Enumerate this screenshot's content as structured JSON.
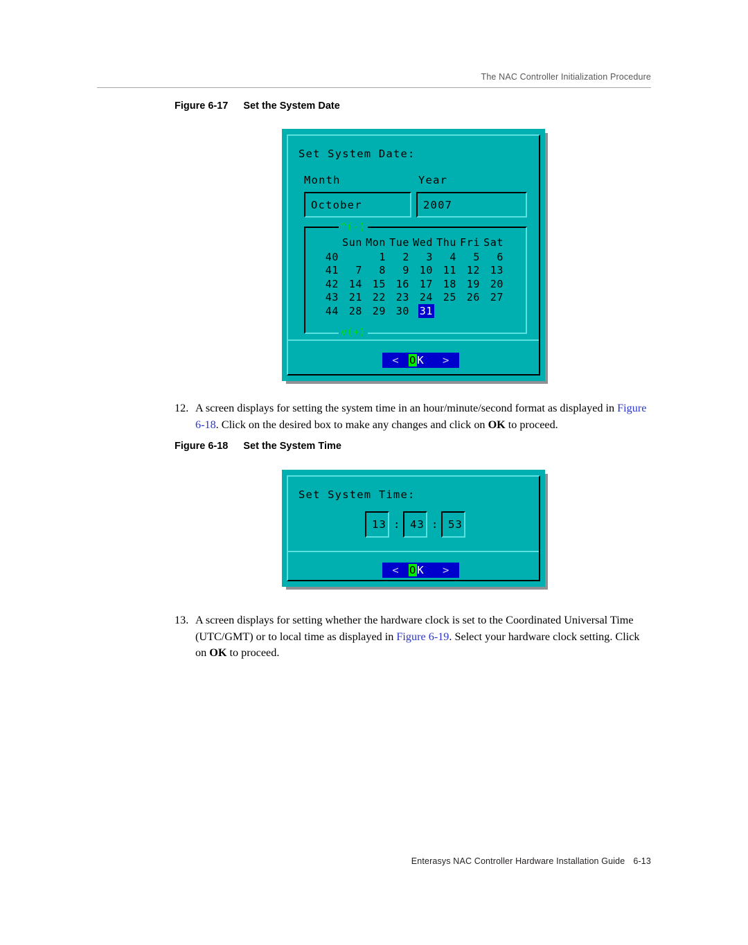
{
  "header": {
    "running_title": "The NAC Controller Initialization Procedure"
  },
  "footer": {
    "guide_title": "Enterasys NAC Controller Hardware Installation Guide",
    "page_number": "6-13"
  },
  "figures": [
    {
      "number": "Figure 6-17",
      "title": "Set the System Date"
    },
    {
      "number": "Figure 6-18",
      "title": "Set the System Time"
    }
  ],
  "steps": [
    {
      "number": "12.",
      "part1": "A screen displays for setting the system time in an hour/minute/second format as displayed in ",
      "xref": "Figure 6-18",
      "part2": ". Click on the desired box to make any changes and click on ",
      "bold": "OK",
      "part3": " to proceed."
    },
    {
      "number": "13.",
      "part1": "A screen displays for setting whether the hardware clock is set to the Coordinated Universal Time (UTC/GMT) or to local time as displayed in ",
      "xref": "Figure 6-19",
      "part2": ". Select your hardware clock setting. Click on ",
      "bold": "OK",
      "part3": " to proceed."
    }
  ],
  "date_dialog": {
    "title": "Set System Date:",
    "month_label": "Month",
    "year_label": "Year",
    "month_value": "October",
    "year_value": "2007",
    "scroll_up": "^(-)",
    "scroll_down": "v(+)",
    "weekday_headers": [
      "",
      "Sun",
      "Mon",
      "Tue",
      "Wed",
      "Thu",
      "Fri",
      "Sat"
    ],
    "weeks": [
      {
        "week": "40",
        "days": [
          "",
          "1",
          "2",
          "3",
          "4",
          "5",
          "6"
        ]
      },
      {
        "week": "41",
        "days": [
          "7",
          "8",
          "9",
          "10",
          "11",
          "12",
          "13"
        ]
      },
      {
        "week": "42",
        "days": [
          "14",
          "15",
          "16",
          "17",
          "18",
          "19",
          "20"
        ]
      },
      {
        "week": "43",
        "days": [
          "21",
          "22",
          "23",
          "24",
          "25",
          "26",
          "27"
        ]
      },
      {
        "week": "44",
        "days": [
          "28",
          "29",
          "30",
          "31",
          "",
          "",
          ""
        ]
      }
    ],
    "selected_day": "31",
    "button": {
      "left_arrow": "<",
      "hotkey": "O",
      "rest": "K",
      "right_arrow": ">"
    }
  },
  "time_dialog": {
    "title": "Set System Time:",
    "hour": "13",
    "minute": "43",
    "second": "53",
    "separator": ":",
    "button": {
      "left_arrow": "<",
      "hotkey": "O",
      "rest": "K",
      "right_arrow": ">"
    }
  },
  "colors": {
    "terminal_bg": "#00b0b0",
    "terminal_light_edge": "#5ae0e0",
    "terminal_dark_edge": "#000000",
    "selection_blue": "#0000cc",
    "hotkey_green": "#00ee00",
    "scroll_green": "#00e000",
    "xref_blue": "#2b35c8",
    "shadow_gray": "#8e9094"
  }
}
